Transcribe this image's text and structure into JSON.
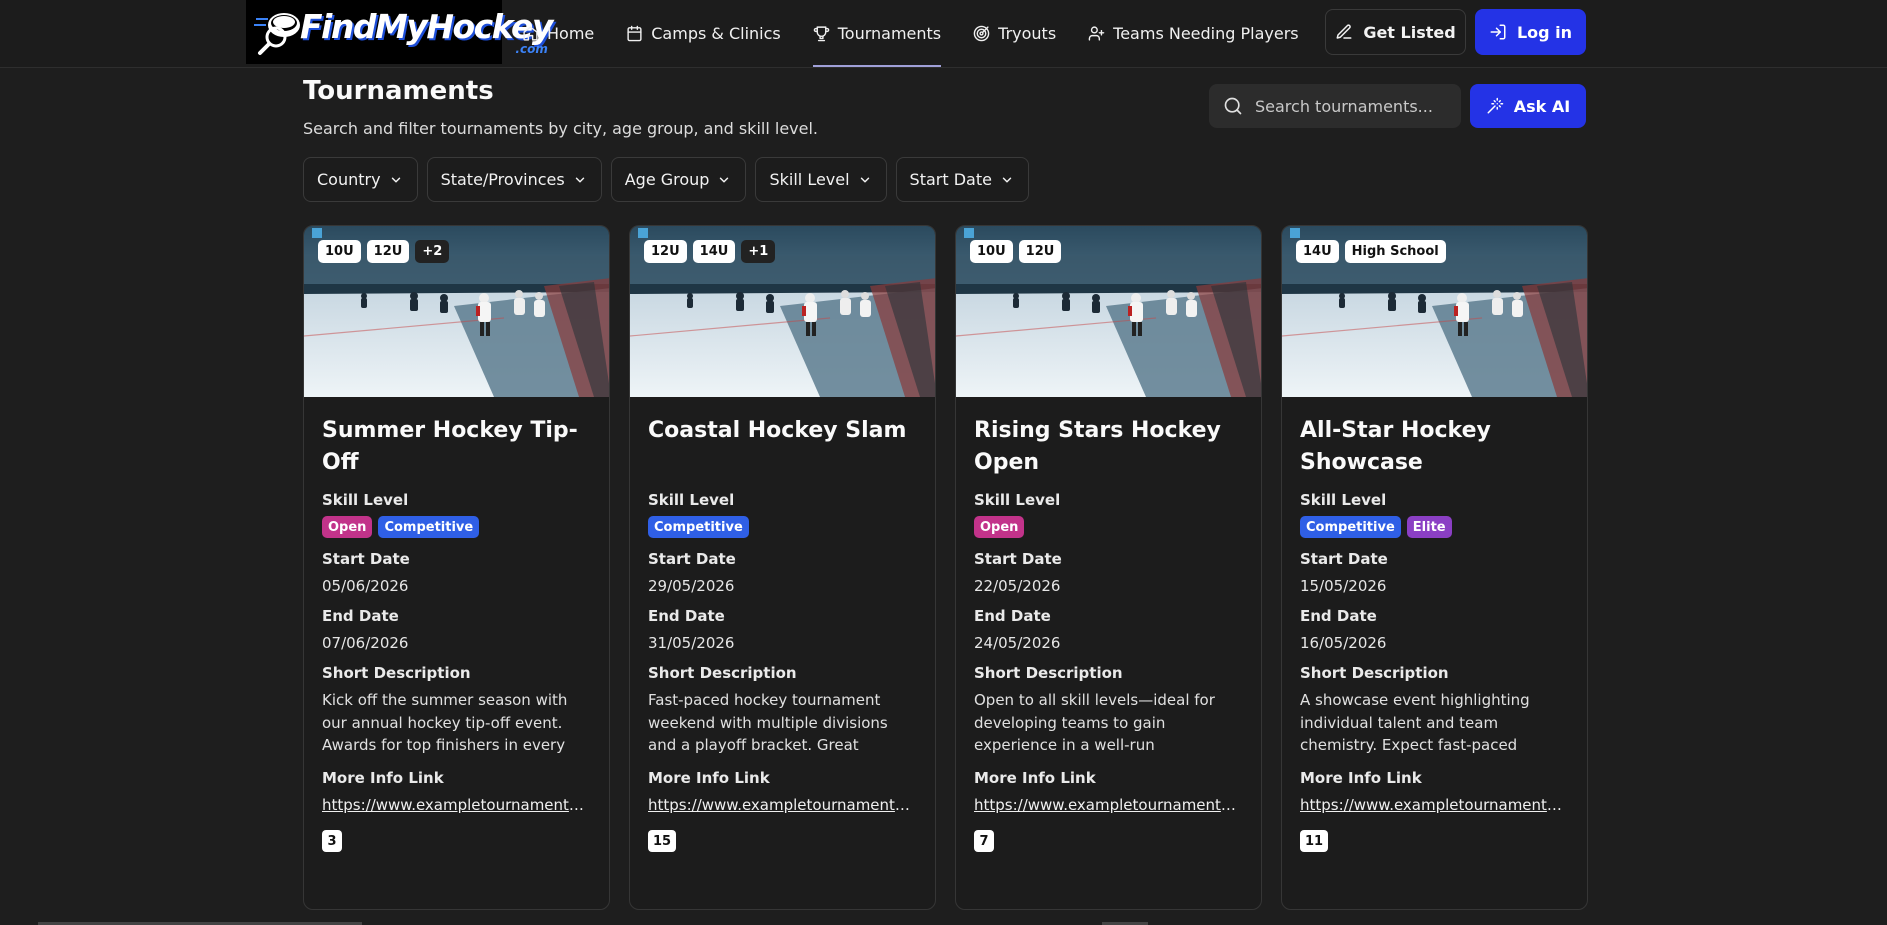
{
  "brand": {
    "name": "FindMyHockey",
    "suffix": ".com"
  },
  "nav": {
    "items": [
      {
        "label": "Home",
        "icon": "home-icon"
      },
      {
        "label": "Camps & Clinics",
        "icon": "calendar-icon"
      },
      {
        "label": "Tournaments",
        "icon": "trophy-icon",
        "active": true
      },
      {
        "label": "Tryouts",
        "icon": "target-icon"
      },
      {
        "label": "Teams Needing Players",
        "icon": "users-icon"
      }
    ],
    "get_listed": "Get Listed",
    "login": "Log in"
  },
  "header": {
    "title": "Tournaments",
    "subtitle": "Search and filter tournaments by city, age group, and skill level.",
    "search_placeholder": "Search tournaments...",
    "ask_ai": "Ask AI"
  },
  "filters": [
    "Country",
    "State/Provinces",
    "Age Group",
    "Skill Level",
    "Start Date"
  ],
  "labels": {
    "skill_level": "Skill Level",
    "start_date": "Start Date",
    "end_date": "End Date",
    "short_description": "Short Description",
    "more_info_link": "More Info Link"
  },
  "skill_colors": {
    "Open": "#c2338a",
    "Competitive": "#2f5fe6",
    "Elite": "#8b3fc4"
  },
  "cards": [
    {
      "tags": [
        "10U",
        "12U",
        "+2"
      ],
      "title": "Summer Hockey Tip-Off",
      "skills": [
        "Open",
        "Competitive"
      ],
      "start_date": "05/06/2026",
      "end_date": "07/06/2026",
      "description": "Kick off the summer season with our annual hockey tip-off event. Awards for top finishers in every division.",
      "link": "https://www.exampletournaments.c...",
      "count": "3"
    },
    {
      "tags": [
        "12U",
        "14U",
        "+1"
      ],
      "title": "Coastal Hockey Slam",
      "skills": [
        "Competitive"
      ],
      "start_date": "29/05/2026",
      "end_date": "31/05/2026",
      "description": "Fast-paced hockey tournament weekend with multiple divisions and a playoff bracket. Great atmosphere...",
      "link": "https://www.exampletournaments.c...",
      "count": "15"
    },
    {
      "tags": [
        "10U",
        "12U"
      ],
      "title": "Rising Stars Hockey Open",
      "skills": [
        "Open"
      ],
      "start_date": "22/05/2026",
      "end_date": "24/05/2026",
      "description": "Open to all skill levels—ideal for developing teams to gain experience in a well-run tournament...",
      "link": "https://www.exampletournaments.c...",
      "count": "7"
    },
    {
      "tags": [
        "14U",
        "High School"
      ],
      "title": "All-Star Hockey Showcase",
      "skills": [
        "Competitive",
        "Elite"
      ],
      "start_date": "15/05/2026",
      "end_date": "16/05/2026",
      "description": "A showcase event highlighting individual talent and team chemistry. Expect fast-paced games, skills...",
      "link": "https://www.exampletournaments.c...",
      "count": "11"
    }
  ]
}
